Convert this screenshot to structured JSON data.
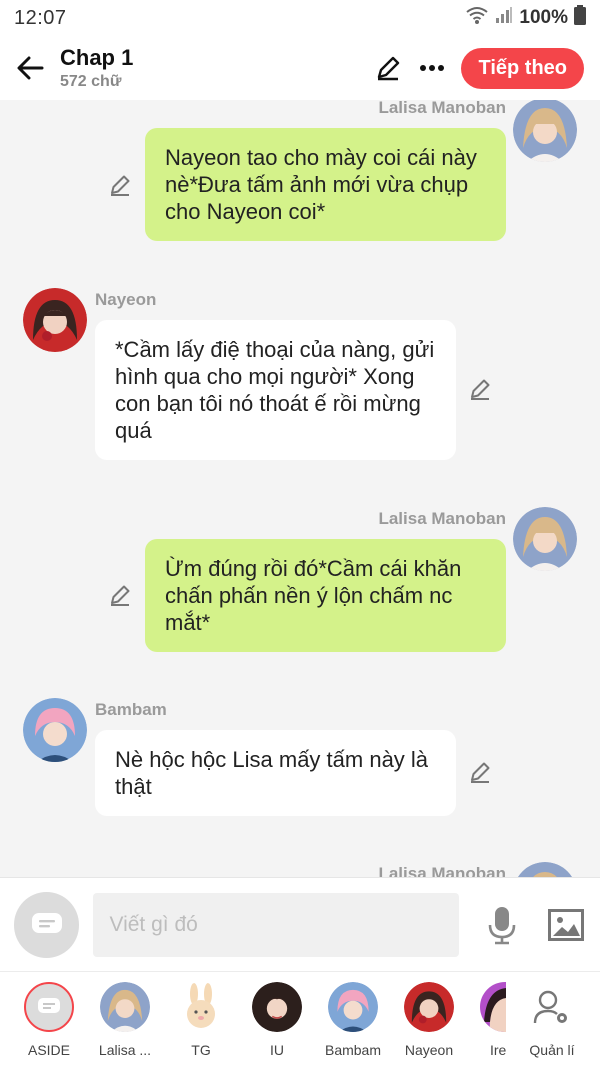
{
  "status": {
    "time": "12:07",
    "battery": "100%"
  },
  "header": {
    "title": "Chap 1",
    "word_count": "572 chữ",
    "next_label": "Tiếp theo"
  },
  "messages": [
    {
      "sender": "Lalisa Manoban",
      "side": "right",
      "text": ""
    },
    {
      "sender": "",
      "side": "right",
      "text": "Nayeon tao cho mày coi cái này nè*Đưa tấm ảnh mới vừa chụp cho Nayeon coi*"
    },
    {
      "sender": "Nayeon",
      "side": "left",
      "text": "*Cầm lấy điệ thoại của nàng, gửi hình qua cho mọi người* Xong con bạn tôi nó thoát ế rồi mừng quá"
    },
    {
      "sender": "Lalisa Manoban",
      "side": "right",
      "text": "Ừm đúng rồi đó*Cầm cái khăn chấn phấn nền ý lộn chấm nc mắt*"
    },
    {
      "sender": "Bambam",
      "side": "left",
      "text": "Nè hộc hộc Lisa mấy tấm này là thật"
    },
    {
      "sender": "Lalisa Manoban",
      "side": "right",
      "text": ""
    }
  ],
  "input": {
    "placeholder": "Viết gì đó"
  },
  "characters": [
    {
      "label": "ASIDE"
    },
    {
      "label": "Lalisa ..."
    },
    {
      "label": "TG"
    },
    {
      "label": "IU"
    },
    {
      "label": "Bambam"
    },
    {
      "label": "Nayeon"
    },
    {
      "label": "Ire"
    },
    {
      "label": "Quản lí"
    }
  ],
  "colors": {
    "accent": "#f4454a",
    "bubble_green": "#d4f28a",
    "bubble_white": "#ffffff"
  }
}
